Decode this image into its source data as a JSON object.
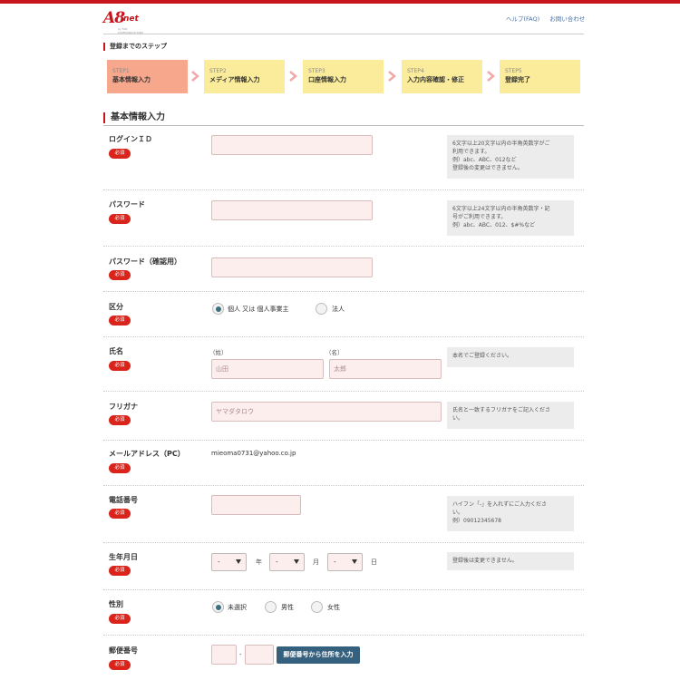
{
  "header": {
    "logo": {
      "a8": "A8",
      "net": "net",
      "sub": "by FAN COMMUNICATIONS"
    },
    "links": [
      "ヘルプ(FAQ)",
      "お問い合わせ"
    ]
  },
  "steps": {
    "title": "登録までのステップ",
    "items": [
      {
        "num": "STEP1",
        "label": "基本情報入力",
        "active": true
      },
      {
        "num": "STEP2",
        "label": "メディア情報入力",
        "active": false
      },
      {
        "num": "STEP3",
        "label": "口座情報入力",
        "active": false
      },
      {
        "num": "STEP4",
        "label": "入力内容確認・修正",
        "active": false
      },
      {
        "num": "STEP5",
        "label": "登録完了",
        "active": false
      }
    ]
  },
  "colors": {
    "brand": "#c8151b",
    "step_active": "#f7a88c",
    "step_inactive": "#faec9a",
    "button": "#35607e"
  },
  "form": {
    "section_title": "基本情報入力",
    "required_label": "必須",
    "login_id": {
      "label": "ログインＩＤ",
      "value": "",
      "hint": [
        "6文字以上20文字以内の半角英数字がご",
        "利用できます。",
        "例）abc、ABC、012など",
        "登録後の変更はできません。"
      ]
    },
    "password": {
      "label": "パスワード",
      "value": "",
      "hint": [
        "6文字以上24文字以内の半角英数字・記",
        "号がご利用できます。",
        "例）abc、ABC、012、$#%など"
      ]
    },
    "password_confirm": {
      "label": "パスワード（確認用）",
      "value": ""
    },
    "category": {
      "label": "区分",
      "options": [
        "個人 又は 個人事業主",
        "法人"
      ],
      "selected": 0
    },
    "name": {
      "label": "氏名",
      "last_label": "（姓）",
      "first_label": "（名）",
      "last_placeholder": "山田",
      "first_placeholder": "太郎",
      "hint": [
        "本名でご登録ください。"
      ]
    },
    "furigana": {
      "label": "フリガナ",
      "placeholder": "ヤマダタロウ",
      "hint": [
        "氏名と一致するフリガナをご記入くださ",
        "い。"
      ]
    },
    "email": {
      "label": "メールアドレス（PC）",
      "value": "mieoma0731@yahoo.co.jp"
    },
    "phone": {
      "label": "電話番号",
      "value": "",
      "hint": [
        "ハイフン「-」を入れずにご入力くださ",
        "い。",
        "例）09012345678"
      ]
    },
    "birthdate": {
      "label": "生年月日",
      "year": "-",
      "month": "-",
      "day": "-",
      "unit_year": "年",
      "unit_month": "月",
      "unit_day": "日",
      "hint": [
        "登録後は変更できません。"
      ]
    },
    "gender": {
      "label": "性別",
      "options": [
        "未選択",
        "男性",
        "女性"
      ],
      "selected": 0
    },
    "postal": {
      "label": "郵便番号",
      "separator": "-",
      "button": "郵便番号から住所を入力"
    }
  }
}
